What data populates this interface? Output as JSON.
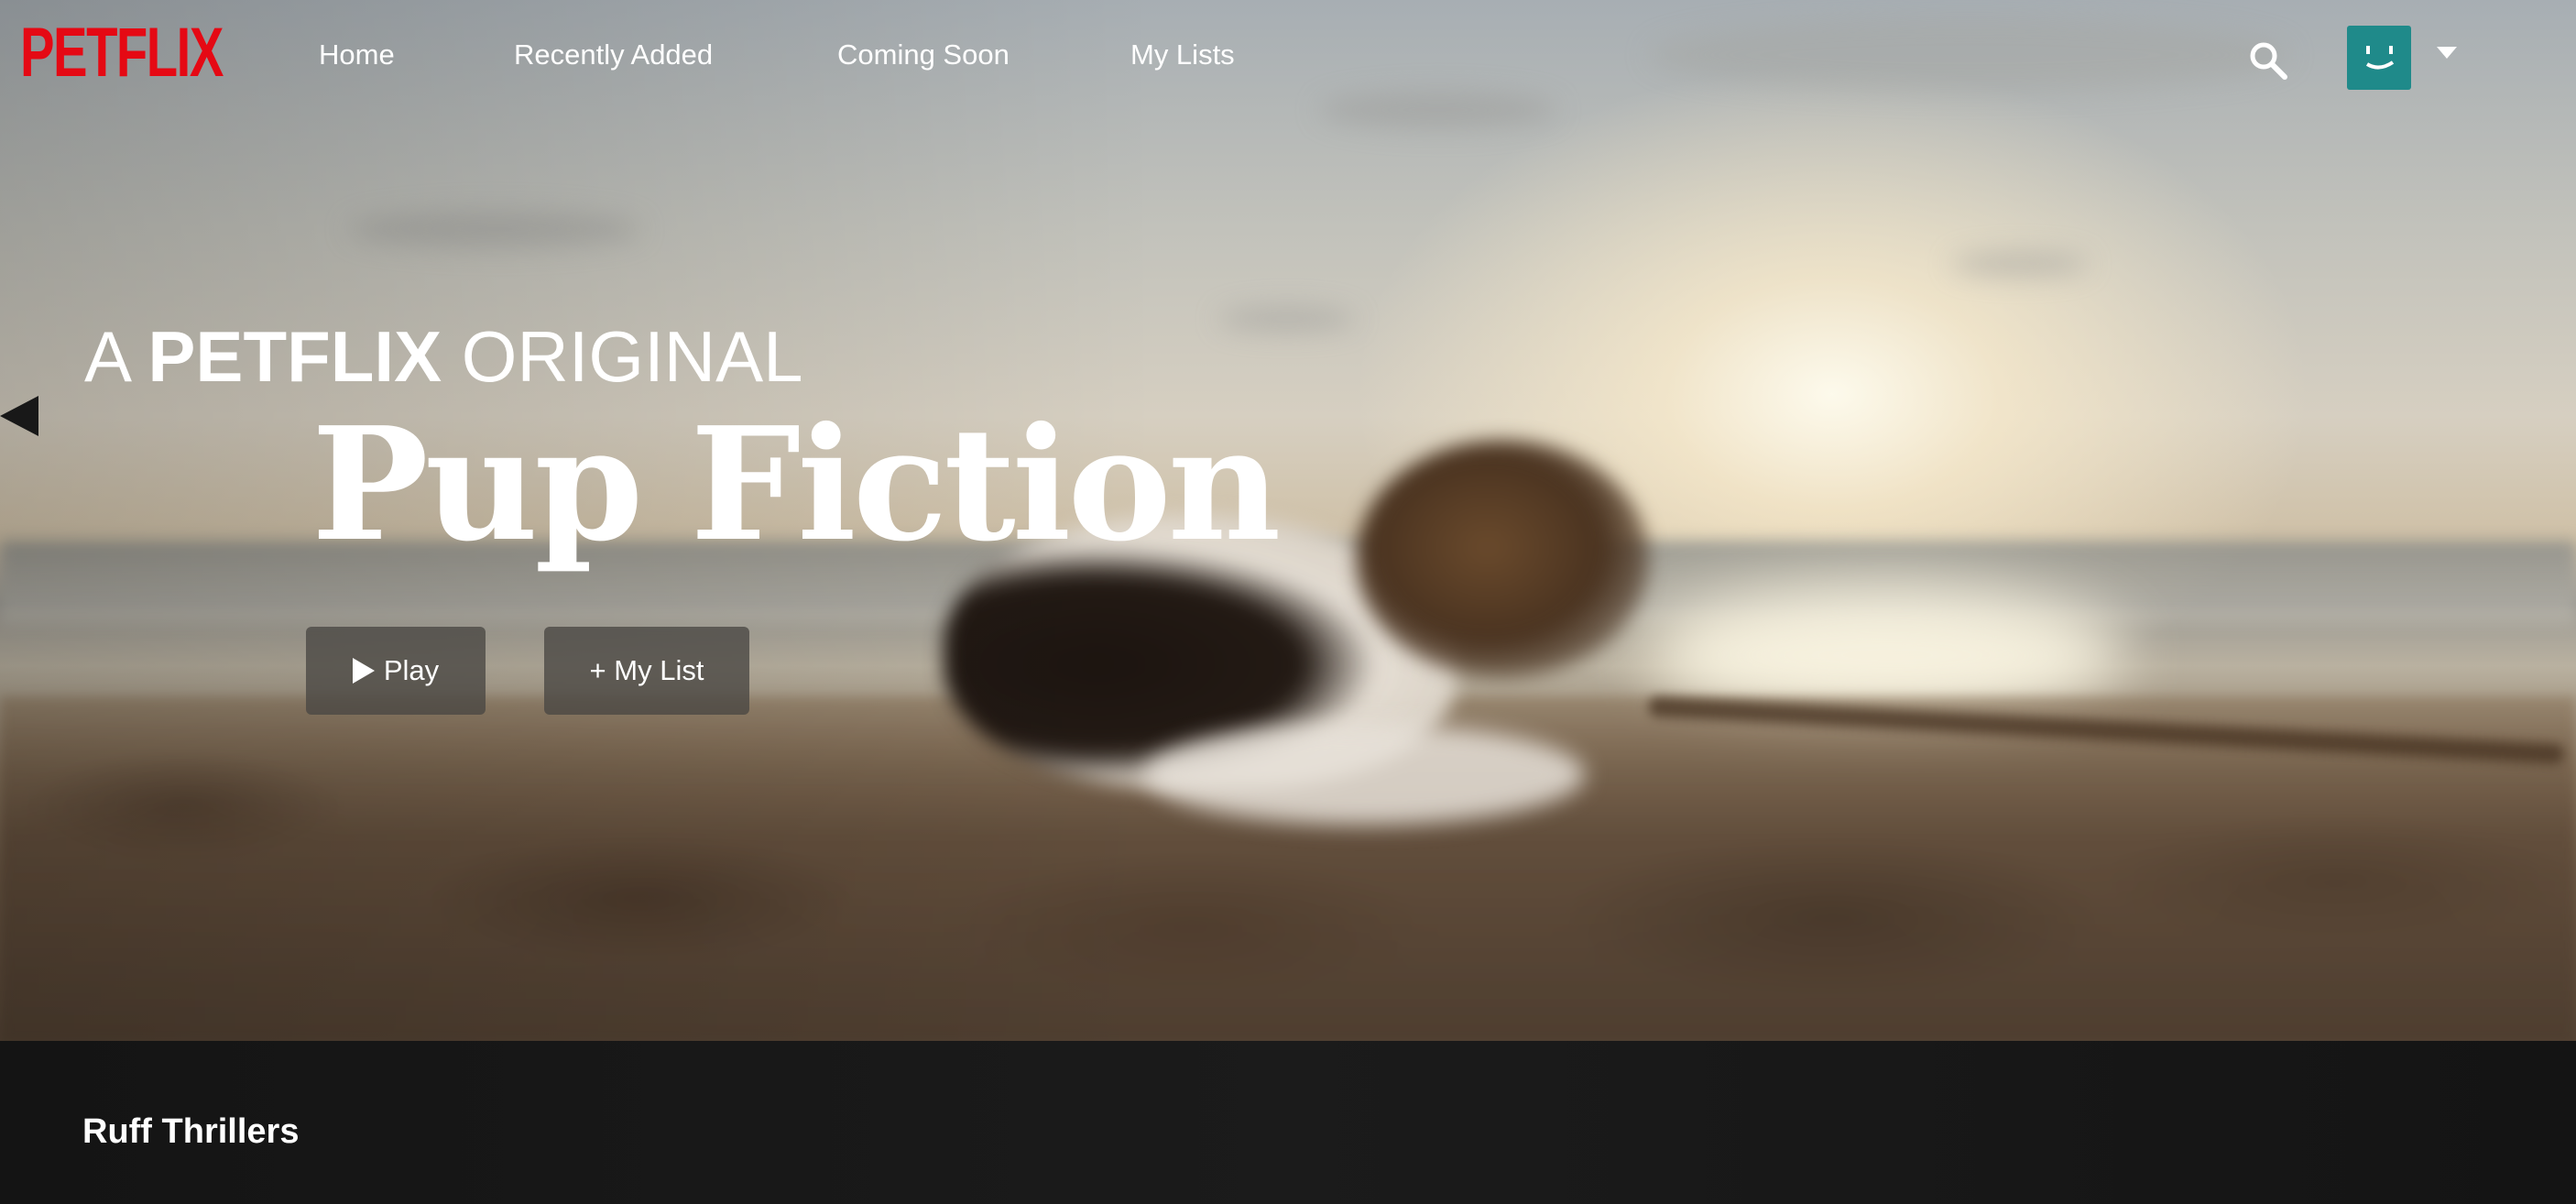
{
  "brand": {
    "logo_text": "PETFLIX",
    "logo_color": "#e50914"
  },
  "nav": {
    "links": [
      {
        "label": "Home"
      },
      {
        "label": "Recently Added"
      },
      {
        "label": "Coming Soon"
      },
      {
        "label": "My Lists"
      }
    ],
    "search_icon": "search-icon",
    "avatar_icon": "smiley-avatar-icon",
    "avatar_color": "#1f8a8a",
    "menu_icon": "caret-down-icon"
  },
  "hero": {
    "original_prefix": "A",
    "original_brand": "PETFLIX",
    "original_suffix": "ORIGINAL",
    "title": "Pup Fiction",
    "play_label": "Play",
    "my_list_label": "+ My List"
  },
  "rows": [
    {
      "title": "Ruff Thrillers"
    }
  ]
}
